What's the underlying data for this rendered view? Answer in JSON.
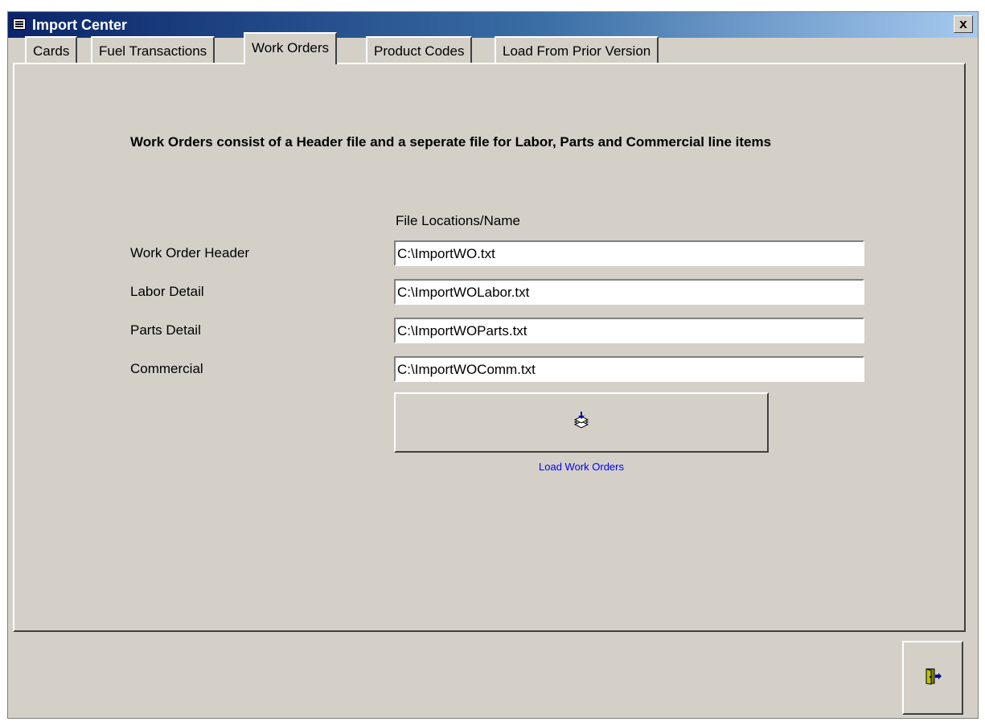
{
  "window": {
    "title": "Import Center",
    "close_symbol": "x",
    "icon": "form-icon"
  },
  "tabs": [
    {
      "label": "Cards",
      "active": false
    },
    {
      "label": "Fuel Transactions",
      "active": false
    },
    {
      "label": "Work Orders",
      "active": true
    },
    {
      "label": "Product Codes",
      "active": false
    },
    {
      "label": "Load From Prior Version",
      "active": false
    }
  ],
  "panel": {
    "heading": "Work Orders consist of a Header file and a seperate file for Labor, Parts and Commercial line items",
    "column_header": "File Locations/Name",
    "rows": [
      {
        "label": "Work Order Header",
        "value": "C:\\ImportWO.txt"
      },
      {
        "label": "Labor Detail",
        "value": "C:\\ImportWOLabor.txt"
      },
      {
        "label": "Parts Detail",
        "value": "C:\\ImportWOParts.txt"
      },
      {
        "label": "Commercial",
        "value": "C:\\ImportWOComm.txt"
      }
    ],
    "load_button": {
      "caption": "Load Work Orders",
      "icon": "stacked-papers-download-icon"
    }
  },
  "exit_button": {
    "icon": "exit-door-icon"
  }
}
